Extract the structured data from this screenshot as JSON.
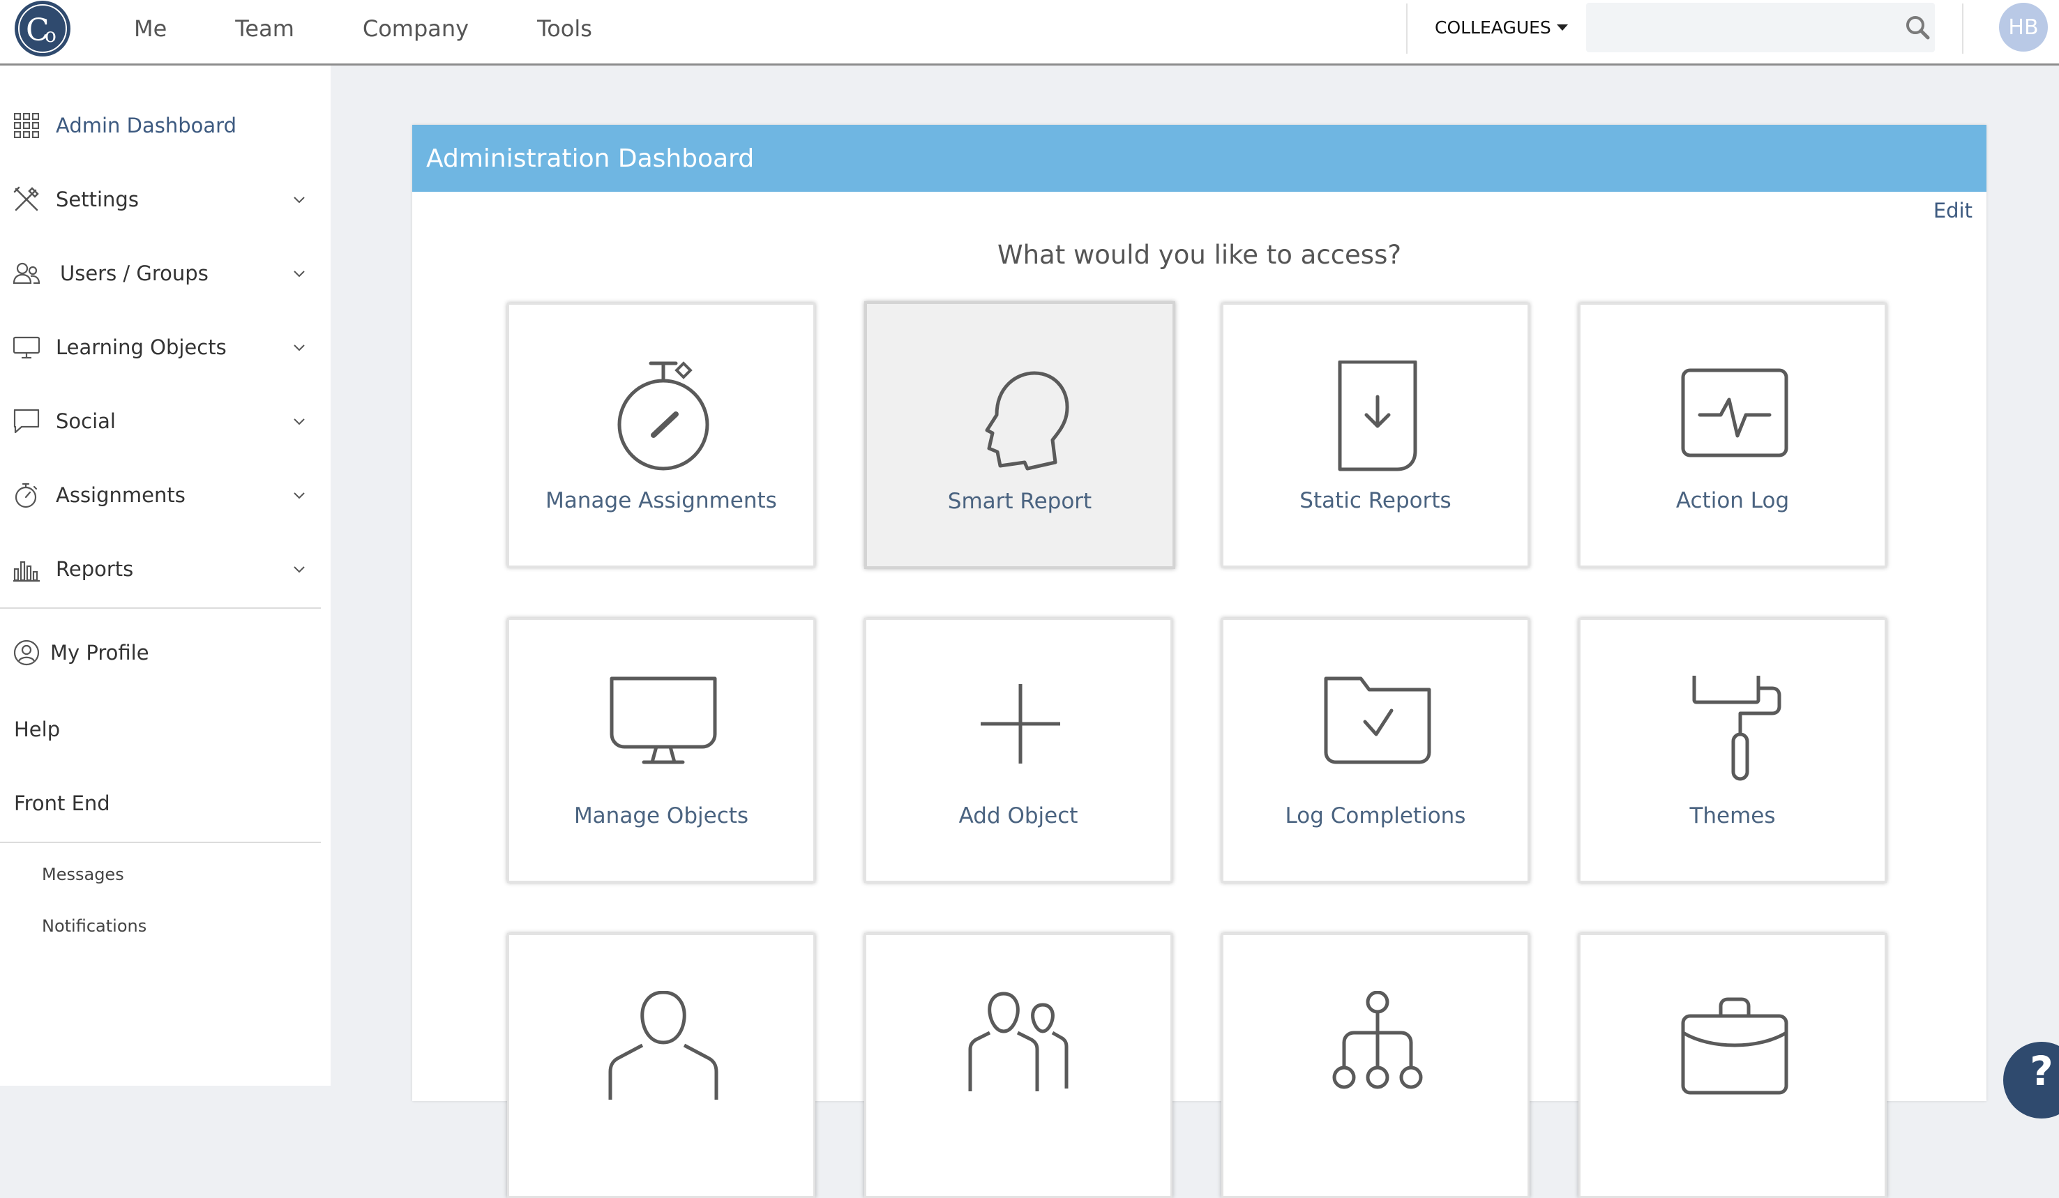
{
  "brand": {
    "logo_text": "Co",
    "logo_color": "#2f4a6e"
  },
  "nav": {
    "links": [
      "Me",
      "Team",
      "Company",
      "Tools"
    ]
  },
  "header_right": {
    "colleagues_label": "COLLEAGUES",
    "search_value": "",
    "search_placeholder": "",
    "avatar_initials": "HB"
  },
  "sidebar": {
    "items": [
      {
        "label": "Admin Dashboard",
        "icon": "grid-icon",
        "active": true,
        "expandable": false
      },
      {
        "label": "Settings",
        "icon": "tools-icon",
        "expandable": true
      },
      {
        "label": "Users / Groups",
        "icon": "users-icon",
        "expandable": true
      },
      {
        "label": "Learning Objects",
        "icon": "monitor-icon",
        "expandable": true
      },
      {
        "label": "Social",
        "icon": "chat-bubble-icon",
        "expandable": true
      },
      {
        "label": "Assignments",
        "icon": "stopwatch-icon",
        "expandable": true
      },
      {
        "label": "Reports",
        "icon": "bar-chart-icon",
        "expandable": true
      }
    ],
    "profile": {
      "label": "My Profile",
      "icon": "user-circle-icon"
    },
    "help": "Help",
    "front_end": "Front End",
    "sub_links": [
      "Messages",
      "Notifications"
    ]
  },
  "panel": {
    "title": "Administration Dashboard",
    "edit_label": "Edit",
    "prompt": "What would you like to access?",
    "header_color": "#6fb6e2",
    "tiles": [
      {
        "label": "Manage Assignments",
        "icon": "stopwatch-icon"
      },
      {
        "label": "Smart Report",
        "icon": "head-icon",
        "hovered": true
      },
      {
        "label": "Static Reports",
        "icon": "download-document-icon"
      },
      {
        "label": "Action Log",
        "icon": "activity-pulse-icon"
      },
      {
        "label": "Manage Objects",
        "icon": "monitor-icon"
      },
      {
        "label": "Add Object",
        "icon": "plus-icon"
      },
      {
        "label": "Log Completions",
        "icon": "folder-check-icon"
      },
      {
        "label": "Themes",
        "icon": "paint-roller-icon"
      },
      {
        "label": "",
        "icon": "user-icon"
      },
      {
        "label": "",
        "icon": "group-icon"
      },
      {
        "label": "",
        "icon": "hierarchy-icon"
      },
      {
        "label": "",
        "icon": "briefcase-icon"
      }
    ]
  },
  "help_bubble": {
    "text": "?",
    "color": "#2f4a6e"
  }
}
